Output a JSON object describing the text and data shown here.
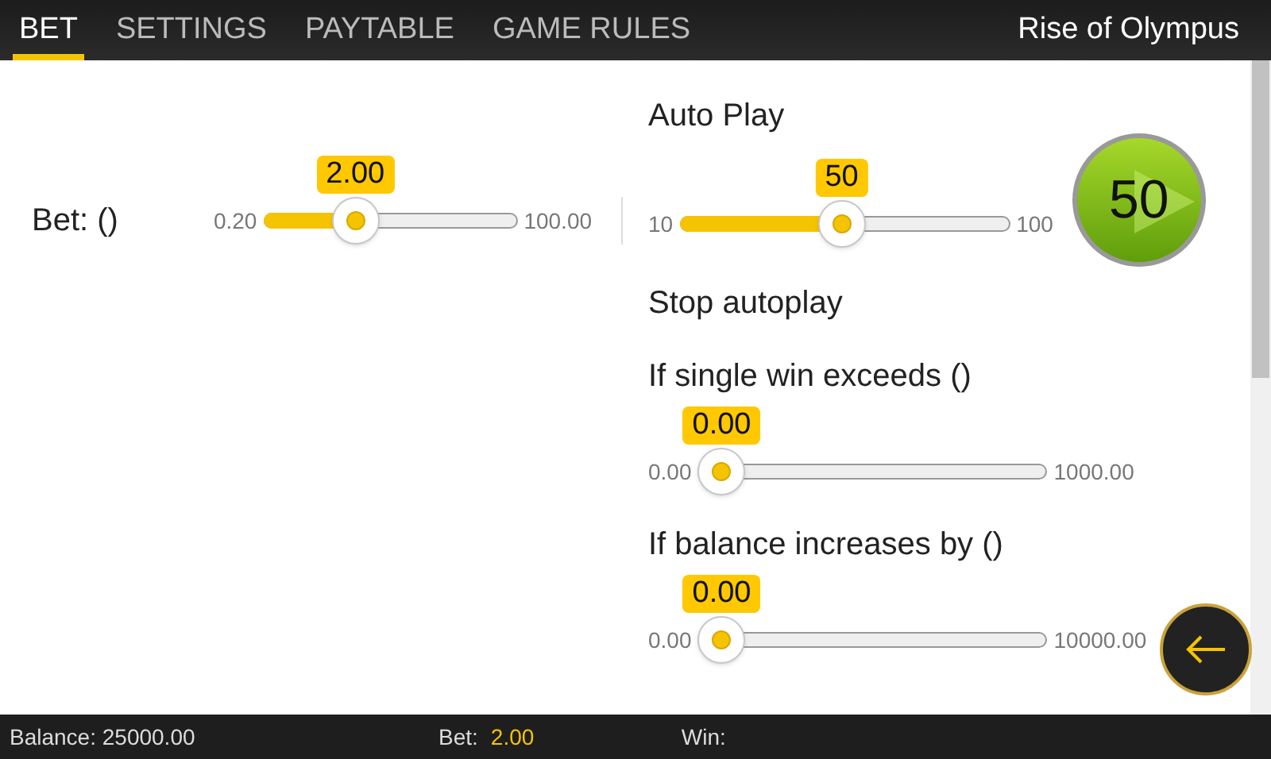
{
  "tabs": [
    {
      "label": "BET",
      "selected": true
    },
    {
      "label": "SETTINGS",
      "selected": false
    },
    {
      "label": "PAYTABLE",
      "selected": false
    },
    {
      "label": "GAME RULES",
      "selected": false
    }
  ],
  "game_title": "Rise of Olympus",
  "bet_panel": {
    "label": "Bet: ()",
    "slider": {
      "value": "2.00",
      "min": "0.20",
      "max": "100.00",
      "level": 0.33
    }
  },
  "auto_play": {
    "title": "Auto Play",
    "slider": {
      "value": "50",
      "min": "10",
      "max": "100",
      "level": 0.49
    },
    "start_button": {
      "label": "50"
    }
  },
  "stop_autoplay": {
    "title": "Stop autoplay",
    "conditions": [
      {
        "label": "If single win exceeds ()",
        "slider": {
          "value": "0.00",
          "min": "0.00",
          "max": "1000.00"
        }
      },
      {
        "label": "If balance increases by ()",
        "slider": {
          "value": "0.00",
          "min": "0.00",
          "max": "10000.00"
        }
      }
    ]
  },
  "status_bar": {
    "balance": "Balance: 25000.00",
    "bet_label": "Bet:",
    "bet_value": "2.00",
    "win_label": "Win:"
  }
}
